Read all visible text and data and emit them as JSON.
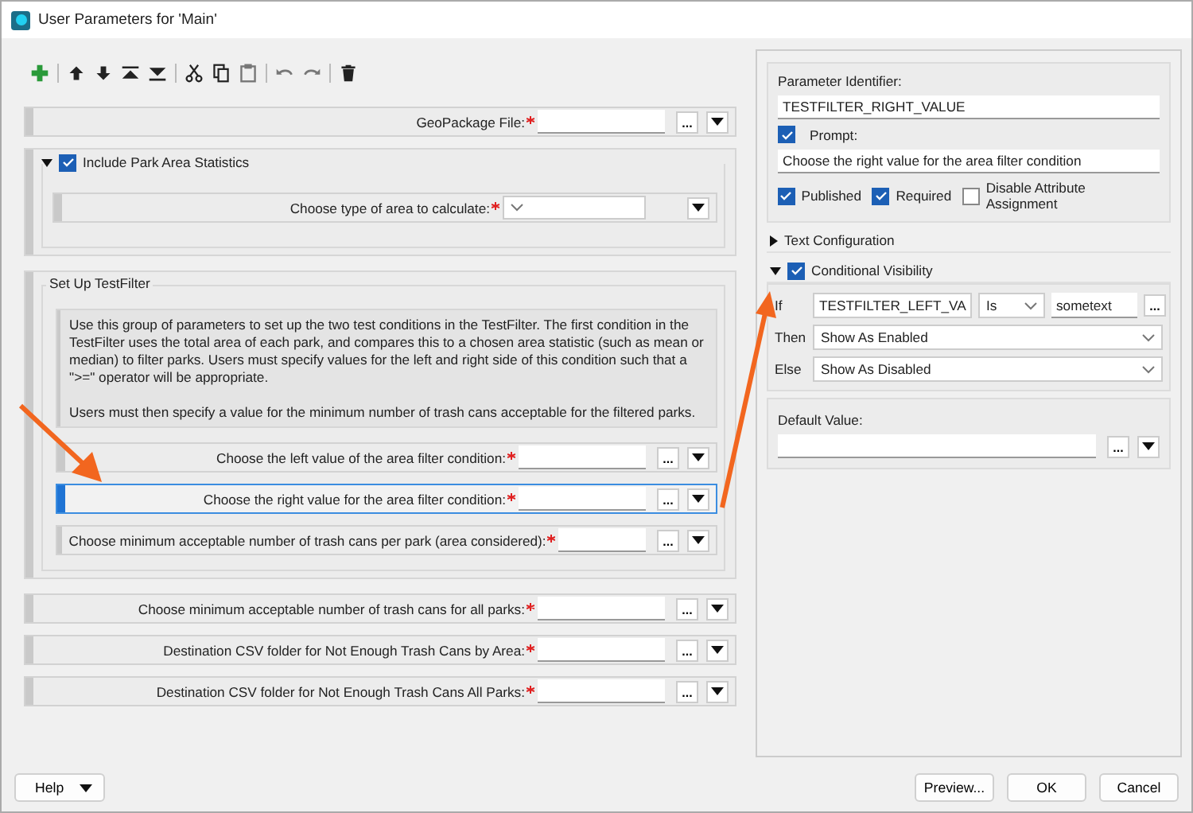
{
  "window": {
    "title": "User Parameters for 'Main'"
  },
  "parameters": [
    {
      "kind": "row",
      "label": "GeoPackage File:",
      "required": true,
      "browse": "...",
      "selected": false
    },
    {
      "kind": "group",
      "title": "Include Park Area Statistics",
      "checked": true,
      "expanded": true,
      "children": [
        {
          "kind": "choice_row",
          "label": "Choose type of area to calculate:",
          "required": true,
          "selected": false
        }
      ]
    },
    {
      "kind": "group",
      "title": "Set Up TestFilter",
      "children": [
        {
          "kind": "description",
          "paragraphs": [
            "Use this group of parameters to set up the two test conditions in the TestFilter. The first condition in the TestFilter uses the total area of each park, and compares this to a chosen area statistic (such as mean or median) to filter parks. Users must specify values for the left and right side of this condition such that a \">=\" operator will be appropriate.",
            "Users must then specify a value for the minimum number of trash cans acceptable for the filtered parks."
          ]
        },
        {
          "kind": "row",
          "label": "Choose the left value of the area filter condition:",
          "required": true,
          "browse": "...",
          "selected": false
        },
        {
          "kind": "row",
          "label": "Choose the right value for the area filter condition:",
          "required": true,
          "browse": "...",
          "selected": true
        },
        {
          "kind": "row",
          "label": "Choose minimum acceptable number of trash cans per park (area considered):",
          "required": true,
          "browse": "...",
          "selected": false
        }
      ]
    },
    {
      "kind": "row",
      "label": "Choose minimum acceptable number of trash cans for all parks:",
      "required": true,
      "browse": "...",
      "selected": false
    },
    {
      "kind": "row",
      "label": "Destination CSV folder for Not Enough Trash Cans by Area:",
      "required": true,
      "browse": "...",
      "selected": false
    },
    {
      "kind": "row",
      "label": "Destination CSV folder for Not Enough Trash Cans All Parks:",
      "required": true,
      "browse": "...",
      "selected": false
    }
  ],
  "properties": {
    "identifier_label": "Parameter Identifier:",
    "identifier": "TESTFILTER_RIGHT_VALUE",
    "prompt": {
      "label": "Prompt:",
      "checked": true,
      "value": "Choose the right value for the area filter condition"
    },
    "options": [
      {
        "label": "Published",
        "checked": true
      },
      {
        "label": "Required",
        "checked": true
      },
      {
        "label": "Disable Attribute Assignment",
        "checked": false
      }
    ],
    "sections": [
      {
        "title": "Text Configuration",
        "expanded": false
      },
      {
        "title": "Conditional Visibility",
        "expanded": true,
        "checked": true
      }
    ],
    "conditions": [
      {
        "label": "If",
        "fields": [
          {
            "kind": "combo",
            "value": "TESTFILTER_LEFT_VA"
          },
          {
            "kind": "combo",
            "value": "Is"
          },
          {
            "kind": "text",
            "value": "sometext"
          }
        ],
        "browse": "..."
      },
      {
        "label": "Then",
        "fields": [
          {
            "kind": "combo",
            "value": "Show As Enabled"
          }
        ]
      },
      {
        "label": "Else",
        "fields": [
          {
            "kind": "combo",
            "value": "Show As Disabled"
          }
        ]
      }
    ],
    "default_label": "Default Value:",
    "default_browse": "..."
  },
  "buttons": {
    "help": "Help",
    "actions": [
      "Preview...",
      "OK",
      "Cancel"
    ]
  }
}
